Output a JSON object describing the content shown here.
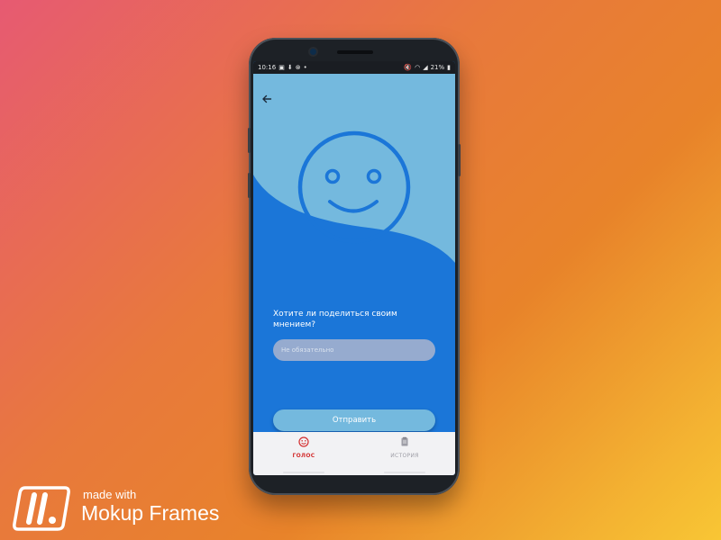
{
  "status_bar": {
    "time": "10:16",
    "battery": "21%"
  },
  "icons": {
    "back": "arrow-left-icon",
    "hero": "smiley-face-icon",
    "vote_tab": "smiley-face-icon",
    "history_tab": "document-icon"
  },
  "survey": {
    "question": "Хотите ли поделиться своим мнением?",
    "comment_placeholder": "Не обязательно",
    "submit_label": "Отправить"
  },
  "bottom_nav": {
    "tabs": [
      {
        "label": "ГОЛОС",
        "active": true
      },
      {
        "label": "ИСТОРИЯ",
        "active": false
      }
    ]
  },
  "colors": {
    "primary_blue": "#1b76d8",
    "light_blue": "#74b9de",
    "active_tab": "#d32f2f"
  },
  "watermark": {
    "line1": "made with",
    "line2": "Mokup Frames"
  }
}
